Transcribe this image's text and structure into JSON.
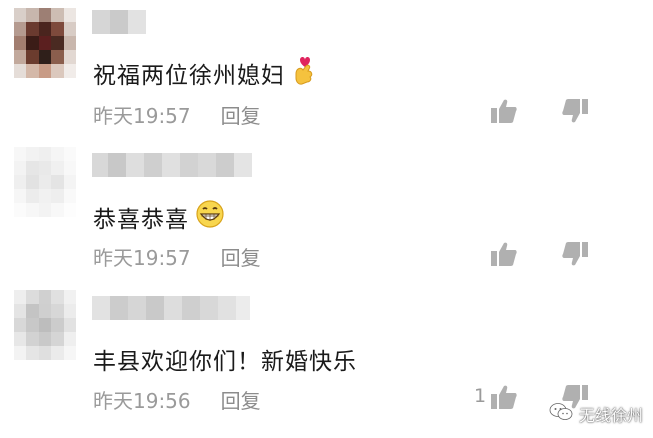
{
  "comments": [
    {
      "text": "祝福两位徐州媳妇",
      "time": "昨天19:57",
      "reply_label": "回复",
      "like_count": "",
      "emoji": "finger-heart"
    },
    {
      "text": "恭喜恭喜",
      "time": "昨天19:57",
      "reply_label": "回复",
      "like_count": "",
      "emoji": "grin"
    },
    {
      "text": "丰县欢迎你们！新婚快乐",
      "time": "昨天19:56",
      "reply_label": "回复",
      "like_count": "1",
      "emoji": ""
    }
  ],
  "watermark": {
    "text": "无线徐州"
  },
  "colors": {
    "text": "#1a1a1a",
    "meta": "#9a9a9a",
    "icon": "#b0b0b0"
  }
}
